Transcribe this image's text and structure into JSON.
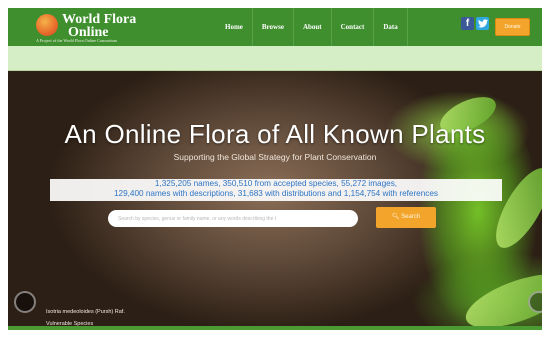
{
  "header": {
    "logo_line1": "World Flora",
    "logo_line2": "Online",
    "logo_subtitle": "A Project of the World Flora Online Consortium",
    "nav": [
      "Home",
      "Browse",
      "About",
      "Contact",
      "Data"
    ],
    "social": {
      "facebook": "f",
      "twitter": "t"
    },
    "donate_label": "Donate"
  },
  "hero": {
    "headline": "An Online Flora of All Known Plants",
    "tagline": "Supporting the Global Strategy for Plant Conservation",
    "stats_line1": "1,325,205 names, 350,510 from accepted species, 55,272 images,",
    "stats_line2": "129,400 names with descriptions, 31,683 with distributions and 1,154,754 with references",
    "search_placeholder": "Search by species, genus or family name, or any words describing the t",
    "search_button": "Search",
    "caption_species": "Isotria medeoloides (Pursh) Raf.",
    "caption_status": "Vulnerable Species"
  },
  "colors": {
    "header_green": "#3f8f2f",
    "subbar_green": "#d6eec6",
    "accent_orange": "#f3a52b",
    "stats_blue": "#2d74c4"
  }
}
